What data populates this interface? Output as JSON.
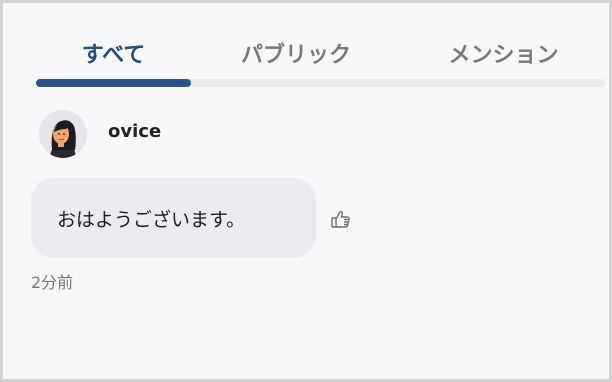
{
  "tabs": [
    {
      "label": "すべて",
      "active": true
    },
    {
      "label": "パブリック",
      "active": false
    },
    {
      "label": "メンション",
      "active": false
    }
  ],
  "colors": {
    "active_tab": "#1f4f80",
    "indicator": "#285486",
    "inactive_tab": "#7a7a7e",
    "bubble": "#ececf0",
    "background": "#f8f8fa"
  },
  "message": {
    "avatar_icon": "woman-avatar-icon",
    "username": "ovice",
    "text": "おはようございます。",
    "timestamp": "2分前",
    "like_icon": "thumbs-up-icon"
  }
}
